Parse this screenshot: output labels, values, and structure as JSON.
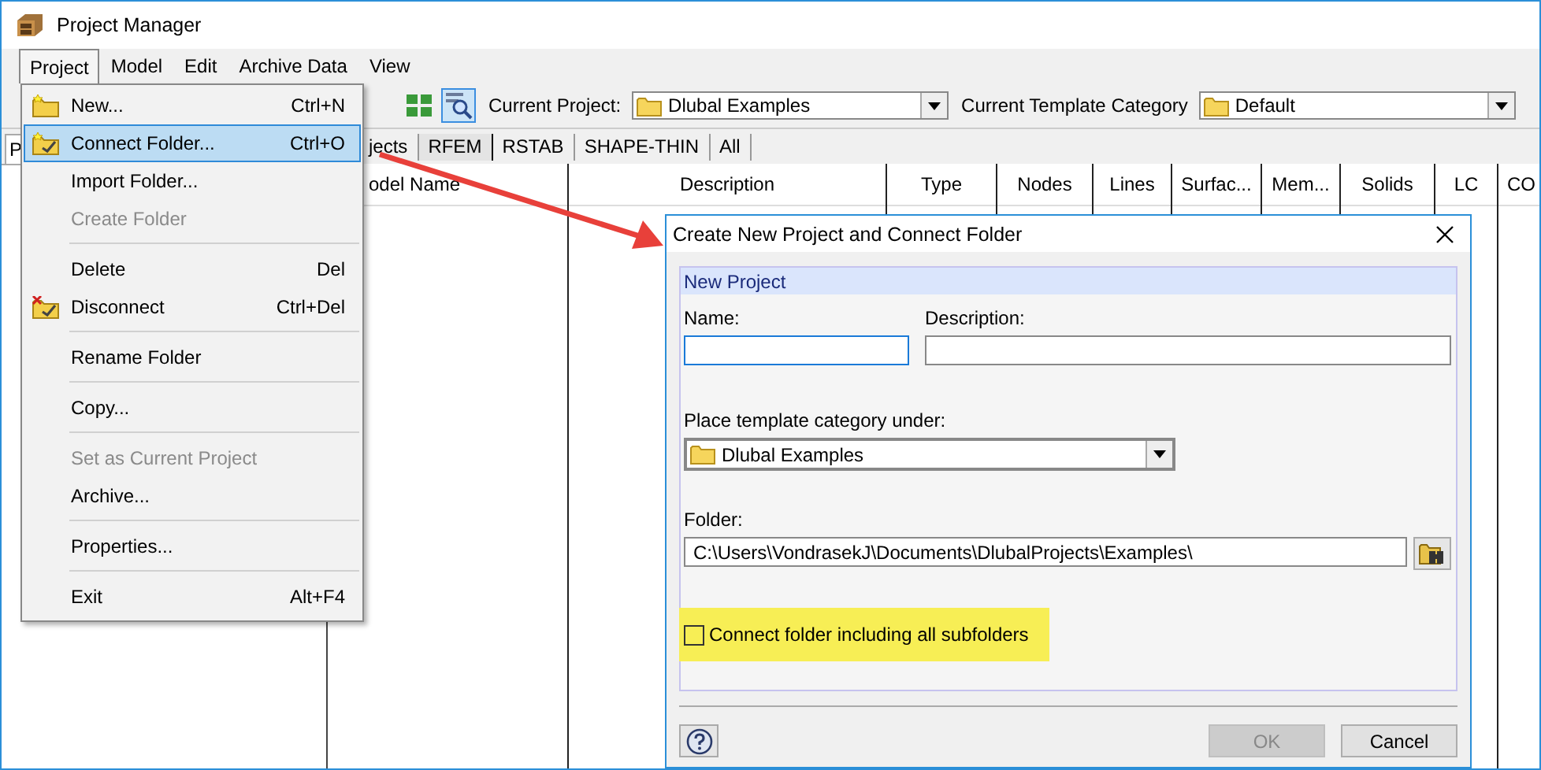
{
  "window": {
    "title": "Project Manager"
  },
  "menu_bar": [
    {
      "label": "Project",
      "selected": true
    },
    {
      "label": "Model",
      "selected": false
    },
    {
      "label": "Edit",
      "selected": false
    },
    {
      "label": "Archive Data",
      "selected": false
    },
    {
      "label": "View",
      "selected": false
    }
  ],
  "toolbar": {
    "tools": [
      {
        "kind": "grid",
        "selected": false
      },
      {
        "kind": "zoom",
        "selected": true
      }
    ],
    "current_project_label": "Current Project:",
    "current_project": "Dlubal Examples",
    "template_category_label": "Current Template Category",
    "template_category": "Default"
  },
  "side_panel": {
    "tabs": [
      {
        "label": "P",
        "selected": true
      }
    ]
  },
  "tabs": [
    {
      "label": "jects",
      "selected": false
    },
    {
      "label": "RFEM",
      "selected": true
    },
    {
      "label": "RSTAB",
      "selected": false
    },
    {
      "label": "SHAPE-THIN",
      "selected": false
    },
    {
      "label": "All",
      "selected": false
    }
  ],
  "table": {
    "columns": [
      "odel Name",
      "Description",
      "Type",
      "Nodes",
      "Lines",
      "Surfac...",
      "Mem...",
      "Solids",
      "LC",
      "CO"
    ]
  },
  "menu": {
    "items": [
      {
        "kind": "new",
        "label": "New...",
        "shortcut": "Ctrl+N",
        "disabled": false,
        "selected": false
      },
      {
        "kind": "connect",
        "label": "Connect Folder...",
        "shortcut": "Ctrl+O",
        "disabled": false,
        "selected": true
      },
      {
        "kind": "plain",
        "label": "Import Folder...",
        "disabled": false,
        "selected": false
      },
      {
        "kind": "plain",
        "label": "Create Folder",
        "disabled": true,
        "selected": false
      },
      {
        "kind": "separator"
      },
      {
        "kind": "plain",
        "label": "Delete",
        "shortcut": "Del",
        "disabled": false,
        "selected": false
      },
      {
        "kind": "disconnect",
        "label": "Disconnect",
        "shortcut": "Ctrl+Del",
        "disabled": false,
        "selected": false
      },
      {
        "kind": "separator"
      },
      {
        "kind": "plain",
        "label": "Rename Folder",
        "disabled": false,
        "selected": false
      },
      {
        "kind": "separator"
      },
      {
        "kind": "plain",
        "label": "Copy...",
        "disabled": false,
        "selected": false
      },
      {
        "kind": "separator"
      },
      {
        "kind": "plain",
        "label": "Set as Current Project",
        "disabled": true,
        "selected": false
      },
      {
        "kind": "plain",
        "label": "Archive...",
        "disabled": false,
        "selected": false
      },
      {
        "kind": "separator"
      },
      {
        "kind": "plain",
        "label": "Properties...",
        "disabled": false,
        "selected": false
      },
      {
        "kind": "separator"
      },
      {
        "kind": "plain",
        "label": "Exit",
        "shortcut": "Alt+F4",
        "disabled": false,
        "selected": false
      }
    ]
  },
  "dialog": {
    "title": "Create New Project and Connect Folder",
    "group_title": "New Project",
    "name_label": "Name:",
    "name_focused": true,
    "description_label": "Description:",
    "category_label": "Place template category under:",
    "category": "Dlubal Examples",
    "folder_label": "Folder:",
    "folder": "C:\\Users\\VondrasekJ\\Documents\\DlubalProjects\\Examples\\",
    "checkbox": {
      "label": "Connect folder including all subfolders",
      "checked": false,
      "highlighted": true
    },
    "buttons": [
      {
        "label": "OK",
        "disabled": true
      },
      {
        "label": "Cancel",
        "disabled": false
      }
    ]
  }
}
